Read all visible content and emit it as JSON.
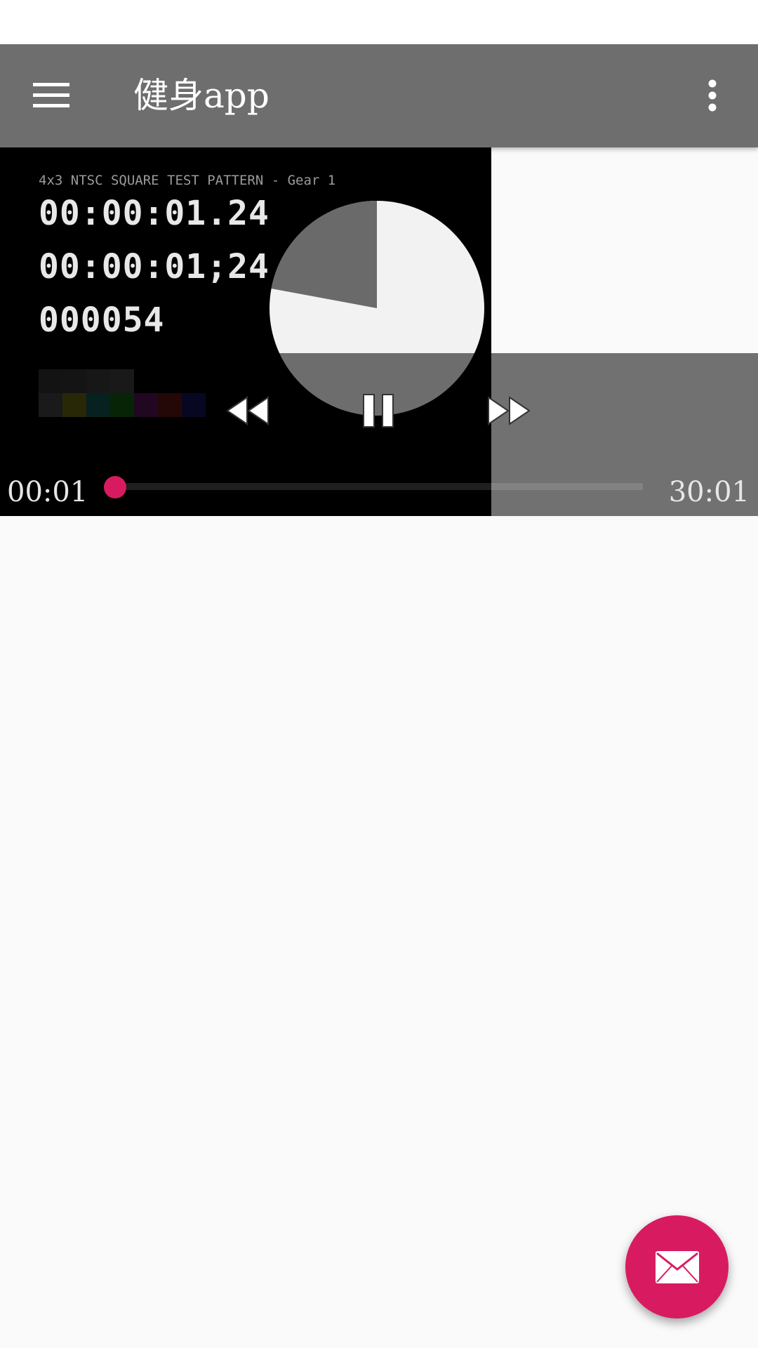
{
  "app_bar": {
    "title": "健身app",
    "menu_icon": "menu-icon",
    "overflow_icon": "more-vert-icon",
    "background": "#6e6e6e"
  },
  "video": {
    "caption": "4x3 NTSC SQUARE TEST PATTERN - Gear 1",
    "timecode_decimal": "00:00:01.24",
    "timecode_drop": "00:00:01;24",
    "frame_number": "000054"
  },
  "player": {
    "current_time": "00:01",
    "total_time": "30:01",
    "progress": 0.0006,
    "rewind_icon": "fast-rewind-icon",
    "pause_icon": "pause-icon",
    "forward_icon": "fast-forward-icon",
    "accent": "#d81b60"
  },
  "fab": {
    "icon": "email-icon",
    "color": "#d81b60"
  }
}
